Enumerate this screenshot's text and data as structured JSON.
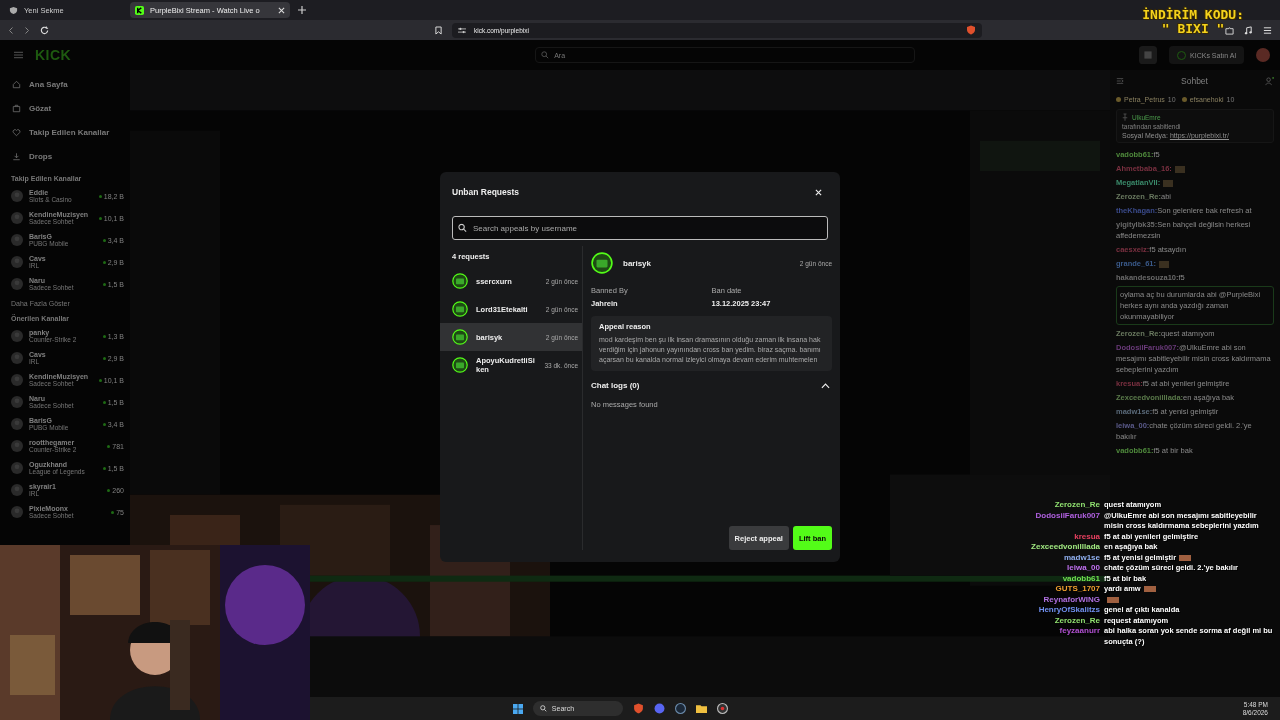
{
  "browser": {
    "tabs": [
      {
        "title": "Yeni Sekme",
        "selected": false
      },
      {
        "title": "PurpleBixi Stream - Watch Live o",
        "selected": true
      }
    ],
    "url": "kick.com/purplebixi"
  },
  "promo": {
    "line_1": "İNDİRİM KODU:",
    "line_2": "\" BIXI \""
  },
  "site": {
    "logo": "KICK",
    "search_placeholder": "Ara",
    "buy_button": "KICKs Satın Al"
  },
  "sidebar": {
    "nav": [
      {
        "label": "Ana Sayfa"
      },
      {
        "label": "Gözat"
      },
      {
        "label": "Takip Edilen Kanallar"
      },
      {
        "label": "Drops"
      }
    ],
    "followed_title": "Takip Edilen Kanallar",
    "followed": [
      {
        "name": "Eddie",
        "category": "Slots & Casino",
        "viewers": "18,2 B"
      },
      {
        "name": "KendineMuzisyen",
        "category": "Sadece Sohbet",
        "viewers": "10,1 B"
      },
      {
        "name": "BarisG",
        "category": "PUBG Mobile",
        "viewers": "3,4 B"
      },
      {
        "name": "Cavs",
        "category": "IRL",
        "viewers": "2,9 B"
      },
      {
        "name": "Naru",
        "category": "Sadece Sohbet",
        "viewers": "1,5 B"
      }
    ],
    "show_more": "Daha Fazla Göster",
    "recommended_title": "Önerilen Kanallar",
    "recommended": [
      {
        "name": "panky",
        "category": "Counter-Strike 2",
        "viewers": "1,3 B"
      },
      {
        "name": "Cavs",
        "category": "IRL",
        "viewers": "2,9 B"
      },
      {
        "name": "KendineMuzisyen",
        "category": "Sadece Sohbet",
        "viewers": "10,1 B"
      },
      {
        "name": "Naru",
        "category": "Sadece Sohbet",
        "viewers": "1,5 B"
      },
      {
        "name": "BarisG",
        "category": "PUBG Mobile",
        "viewers": "3,4 B"
      },
      {
        "name": "rootthegamer",
        "category": "Counter-Strike 2",
        "viewers": "781"
      },
      {
        "name": "Oguzkhand",
        "category": "League of Legends",
        "viewers": "1,5 B"
      },
      {
        "name": "skyrair1",
        "category": "IRL",
        "viewers": "260"
      },
      {
        "name": "PixieMoonx",
        "category": "Sadece Sohbet",
        "viewers": "75"
      }
    ]
  },
  "chat": {
    "title": "Sohbet",
    "top_gifters": [
      {
        "name": "Petra_Petrus",
        "count": "10"
      },
      {
        "name": "efsanehoki",
        "count": "10"
      }
    ],
    "pinned": {
      "author": "UlkuEmre",
      "note": "tarafından sabitlendi",
      "label": "Sosyal Medya:",
      "link": "https://purplebixi.tr/"
    },
    "messages": [
      {
        "user": "vadobb61:",
        "color": "#4f8a3c",
        "text": "f5",
        "emote": false,
        "highlighted": false
      },
      {
        "user": "Ahmetbaba_16:",
        "color": "#7a3040",
        "emote": true,
        "highlighted": false
      },
      {
        "user": "MegatlanVII:",
        "color": "#3a8a6a",
        "emote": true,
        "highlighted": false
      },
      {
        "user": "Zerozen_Re:",
        "color": "#6a7a60",
        "text": "abi",
        "emote": false,
        "highlighted": false
      },
      {
        "user": "theKhagan:",
        "color": "#3a4a8a",
        "text": "Son gelenlere bak refresh at",
        "emote": false,
        "highlighted": false
      },
      {
        "user": "yigitylbk35:",
        "color": "#6a6a6a",
        "text": "Sen bahçeli değilsin herkesi affedemezsin",
        "emote": false,
        "highlighted": false
      },
      {
        "user": "caesxeiz:",
        "color": "#7a3040",
        "text": "f5 atsaydın",
        "emote": false,
        "highlighted": false
      },
      {
        "user": "grande_61:",
        "color": "#3a5a8a",
        "emote": true,
        "highlighted": false
      },
      {
        "user": "hakandesouza10:",
        "color": "#6a6a6a",
        "text": "f5",
        "emote": false,
        "highlighted": false
      },
      {
        "text": "oylama aç bu durumlarda abi @PurpleBixi herkes aynı anda yazdığı zaman okunmayabiliyor",
        "emote": false,
        "highlighted": true
      },
      {
        "user": "Zerozen_Re:",
        "color": "#6a7a60",
        "text": "quest atamıyom",
        "emote": false,
        "highlighted": false
      },
      {
        "user": "DodosilFaruk007:",
        "color": "#6a3a7a",
        "text": "@UlkuEmre abi son mesajımı sabitleyebilir misin cross kaldırmama sebeplerini yazdım",
        "emote": false,
        "highlighted": false
      },
      {
        "user": "kresua:",
        "color": "#7a3040",
        "text": "f5 at abi yenileri gelmiştire",
        "emote": false,
        "highlighted": false
      },
      {
        "user": "Zexceedvonilllada:",
        "color": "#5a7a4a",
        "text": "en aşağıya bak",
        "emote": false,
        "highlighted": false
      },
      {
        "user": "madw1se:",
        "color": "#5a6a7a",
        "text": "f5 at yenisi gelmiştir",
        "emote": false,
        "highlighted": false
      },
      {
        "user": "leiwa_00:",
        "color": "#5a5a8a",
        "text": "chate çözüm süreci geldi. 2.'ye bakılır",
        "emote": false,
        "highlighted": false
      },
      {
        "user": "vadobb61:",
        "color": "#4f8a3c",
        "text": "f5 at bir bak",
        "emote": false,
        "highlighted": false
      }
    ]
  },
  "modal": {
    "title": "Unban Requests",
    "search_placeholder": "Search appeals by username",
    "count": "4 requests",
    "requests": [
      {
        "name": "ssercxurn",
        "time": "2 gün önce",
        "selected": false
      },
      {
        "name": "Lord31Etekalti",
        "time": "2 gün önce",
        "selected": false
      },
      {
        "name": "barisyk",
        "time": "2 gün önce",
        "selected": true
      },
      {
        "name": "ApoyuKudretliSiken",
        "time": "33 dk. önce",
        "selected": false
      }
    ],
    "detail": {
      "name": "barisyk",
      "time": "2 gün önce",
      "banned_by_label": "Banned By",
      "banned_by": "Jahrein",
      "ban_date_label": "Ban date",
      "ban_date": "13.12.2025 23:47",
      "reason_title": "Appeal reason",
      "reason": "mod kardeşim ben şu ilk insan dramasının olduğu zaman ilk insana hak verdiğim için jahonun yayınından cross ban yedim. biraz saçma. banımı açarsan bu kanalda normal izleyici olmaya devam ederim muhtemelen",
      "chat_logs_title": "Chat logs (0)",
      "chat_logs_expanded": true,
      "chat_logs_empty": "No messages found"
    },
    "reject_button": "Reject appeal",
    "lift_button": "Lift ban"
  },
  "overlay_chat": [
    {
      "user": "Zerozen_Re",
      "color": "#90e070",
      "text": "quest atamıyom",
      "emote": false
    },
    {
      "user": "DodosilFaruk007",
      "color": "#b060e0",
      "text": "@UlkuEmre abi son mesajımı sabitleyebilir misin cross kaldırmama sebeplerini yazdım",
      "emote": false
    },
    {
      "user": "kresua",
      "color": "#e84060",
      "text": "f5 at abi yenileri gelmiştire",
      "emote": false
    },
    {
      "user": "Zexceedvonilllada",
      "color": "#a0e880",
      "text": "en aşağıya bak",
      "emote": false
    },
    {
      "user": "madw1se",
      "color": "#90b0f0",
      "text": "f5 at yenisi gelmiştir",
      "emote": true
    },
    {
      "user": "leiwa_00",
      "color": "#c070f0",
      "text": "chate çözüm süreci geldi. 2.'ye bakılır",
      "emote": false
    },
    {
      "user": "vadobb61",
      "color": "#70e050",
      "text": "f5 at bir bak",
      "emote": false
    },
    {
      "user": "GUTS_1707",
      "color": "#f0a030",
      "text": "yardı amw",
      "emote": true
    },
    {
      "user": "ReynaforWING",
      "color": "#b070e0",
      "emote": true
    },
    {
      "user": "HenryOfSkalitzs",
      "color": "#7090f0",
      "text": "genel af çıktı kanalda",
      "emote": false
    },
    {
      "user": "Zerozen_Re",
      "color": "#90e070",
      "text": "request atamıyom",
      "emote": false
    },
    {
      "user": "feyzaanurr",
      "color": "#b050d0",
      "text": "abi halka soran yok sende sorma af değil mi bu sonuçta (?)",
      "emote": false
    }
  ],
  "taskbar": {
    "search": "Search",
    "time": "5:48 PM",
    "date": "8/6/2026"
  }
}
